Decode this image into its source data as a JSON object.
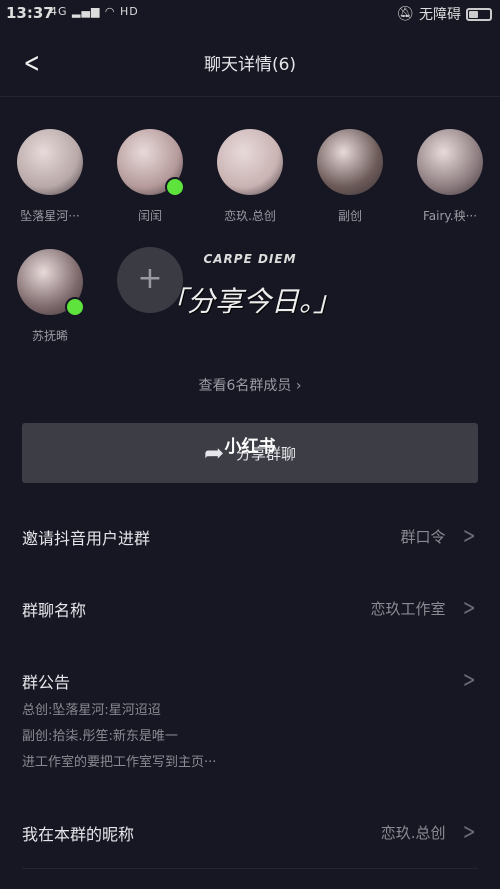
{
  "status": {
    "time": "13:37",
    "signal": "4G",
    "wifi": "HD",
    "accessibility": "无障碍"
  },
  "header": {
    "title": "聊天详情(6)",
    "back": "back"
  },
  "members": [
    {
      "name": "坠落星河···",
      "online": false,
      "color": "#b8a8a8"
    },
    {
      "name": "闰闰",
      "online": true,
      "color": "#b59a9a"
    },
    {
      "name": "恋玖.总创",
      "online": false,
      "color": "#c9b2b2"
    },
    {
      "name": "副创",
      "online": false,
      "color": "#6b5a58"
    },
    {
      "name": "Fairy.秧···",
      "online": false,
      "color": "#8d7d80"
    },
    {
      "name": "苏抚晞",
      "online": true,
      "color": "#7e6a6c"
    }
  ],
  "add_button": "+",
  "watermark": {
    "top": "CARPE DIEM",
    "main": "「分享今日。」",
    "logo": "小红书"
  },
  "view_members": "查看6名群成员",
  "share_button": "分享群聊",
  "rows": {
    "invite": {
      "label": "邀请抖音用户进群",
      "value": "群口令"
    },
    "name": {
      "label": "群聊名称",
      "value": "恋玖工作室"
    },
    "notice": {
      "label": "群公告",
      "lines": [
        "总创:坠落星河:星河迢迢",
        "副创:拾柒.彤笙:新东是唯一",
        "进工作室的要把工作室写到主页···"
      ]
    },
    "nickname": {
      "label": "我在本群的昵称",
      "value": "恋玖.总创"
    }
  }
}
